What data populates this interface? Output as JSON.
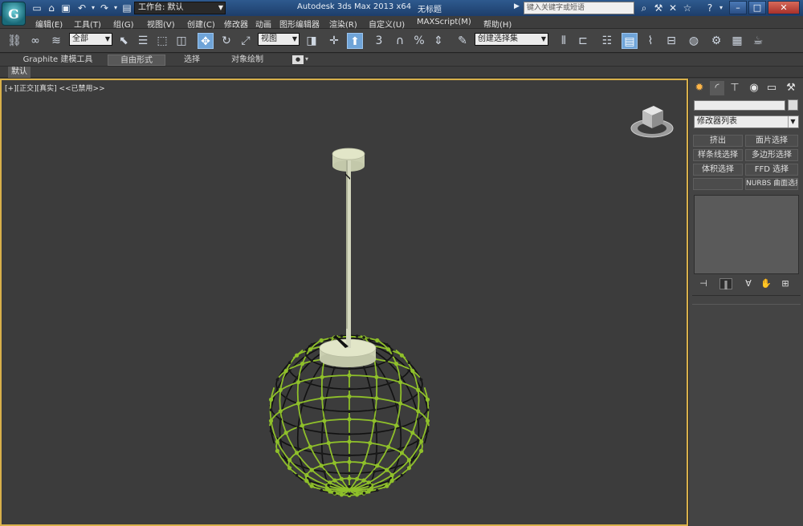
{
  "titlebar": {
    "workspace_label": "工作台: 默认",
    "app_title": "Autodesk 3ds Max  2013 x64",
    "doc_title": "无标题",
    "search_placeholder": "键入关键字或短语",
    "logo_glyph": "G"
  },
  "menu": {
    "items": [
      "编辑(E)",
      "工具(T)",
      "组(G)",
      "视图(V)",
      "创建(C)",
      "修改器",
      "动画",
      "图形编辑器",
      "渲染(R)",
      "自定义(U)",
      "MAXScript(M)",
      "帮助(H)"
    ]
  },
  "toolbar": {
    "selection_filter": "全部",
    "reference_coord": "视图",
    "named_selection": "创建选择集",
    "snap_label": "3"
  },
  "ribbon": {
    "tabs": [
      "Graphite 建模工具",
      "自由形式",
      "选择",
      "对象绘制"
    ],
    "active_tab": 1,
    "subtab": "默认"
  },
  "viewport": {
    "label": "[+][正交][真实]  <<已禁用>>",
    "accent_color": "#d8b04a",
    "mesh_color": "#8fc02a",
    "cap_color": "#e2e6c8"
  },
  "panel": {
    "modifier_list": "修改器列表",
    "buttons": {
      "extrude": "挤出",
      "patch_select": "面片选择",
      "spline_select": "样条线选择",
      "poly_select": "多边形选择",
      "vol_select": "体积选择",
      "ffd_select": "FFD 选择",
      "nurbs_select": "NURBS 曲面选择"
    }
  },
  "icons": {
    "new": "new-file-icon",
    "open": "open-folder-icon",
    "save": "save-icon",
    "undo": "undo-icon",
    "redo": "redo-icon",
    "move": "move-icon",
    "rotate": "rotate-icon"
  }
}
